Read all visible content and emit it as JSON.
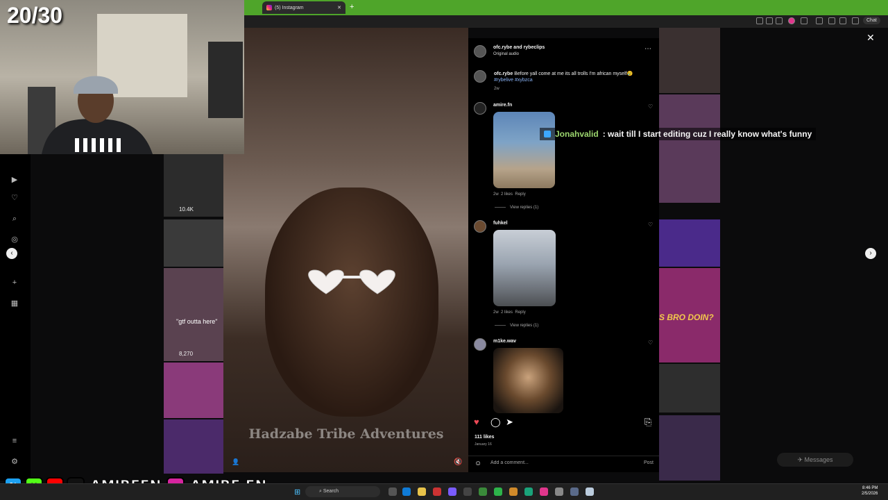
{
  "browser": {
    "tab_title": "(5) Instagram",
    "tab_close": "✕",
    "new_tab": "+",
    "chat_label": "Chat"
  },
  "stream": {
    "counter": "20/30",
    "chat": {
      "user": "Jonahvalid",
      "message": ": wait till I start editing cuz I really know what's funny"
    },
    "socials": {
      "handle1": "AMIREFN",
      "handle2": "AMIRE.FN"
    }
  },
  "feed": {
    "view_counts": [
      "10.4K",
      "8,270"
    ],
    "thumb_text": [
      "\"gtf outta here\"",
      "S BRO DOIN?"
    ]
  },
  "post": {
    "header": {
      "names": "ofc.rybe and rybeclips",
      "audio": "Original audio"
    },
    "watermark": "Hadzabe Tribe Adventures",
    "caption": {
      "user": "ofc.rybe",
      "text": "Before yall come at me its all trolls I'm african myself😢",
      "tags": "#rybelive #xybzca",
      "time": "2w"
    },
    "comments": [
      {
        "user": "amire.fn",
        "time": "2w",
        "likes": "2 likes",
        "reply": "Reply",
        "view_replies": "View replies (1)"
      },
      {
        "user": "fuhkel",
        "time": "2w",
        "likes": "2 likes",
        "reply": "Reply",
        "view_replies": "View replies (1)"
      },
      {
        "user": "m1ke.wav"
      }
    ],
    "likes": "111 likes",
    "date": "January 16",
    "comment_placeholder": "Add a comment...",
    "post_label": "Post"
  },
  "overlay": {
    "messages_label": "Messages"
  },
  "taskbar": {
    "search_label": "Search",
    "time": "8:46 PM",
    "date": "2/5/2026"
  },
  "colors": {
    "tab_green": "#4fa52a",
    "like_red": "#ed4956",
    "chat_user": "#9cd66e"
  }
}
